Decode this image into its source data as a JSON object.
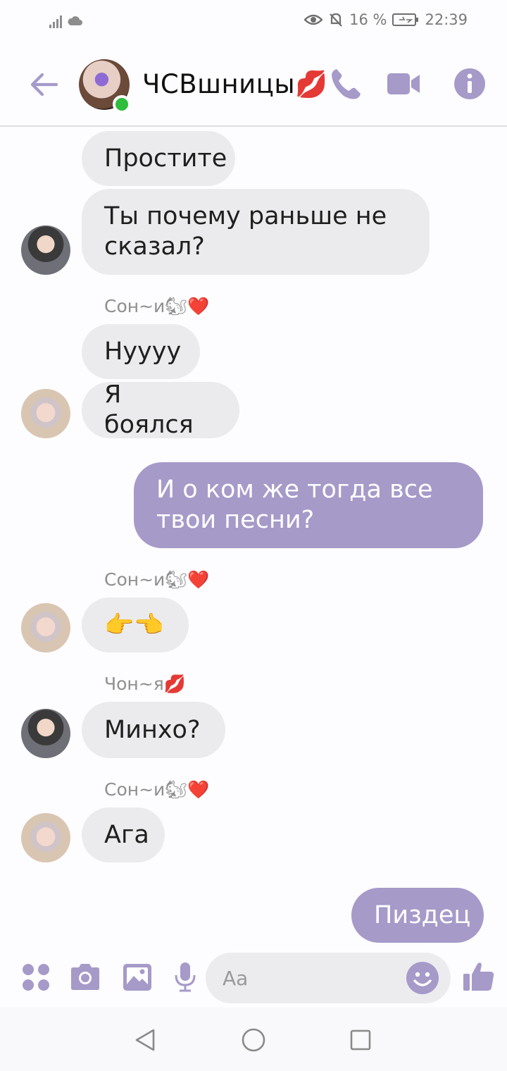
{
  "status": {
    "battery": "16 %",
    "time": "22:39"
  },
  "header": {
    "title": "ЧСВшницы💋"
  },
  "messages": [
    {
      "text": "Простите"
    },
    {
      "text": "Ты почему раньше не\nсказал?"
    },
    {
      "sender": "Сон~и🐿❤️",
      "text": "Нуууу"
    },
    {
      "text": "Я боялся"
    },
    {
      "text": "И о ком же тогда все\nтвои песни?"
    },
    {
      "sender": "Сон~и🐿❤️",
      "text": "👉👈"
    },
    {
      "sender": "Чон~я💋",
      "text": "Минхо?"
    },
    {
      "sender": "Сон~и🐿❤️",
      "text": "Ага"
    },
    {
      "text": "Пиздец"
    }
  ],
  "input": {
    "placeholder": "Aa"
  },
  "colors": {
    "accent": "#a69ac9",
    "incoming": "#ebebed",
    "online": "#2ebd3c"
  }
}
